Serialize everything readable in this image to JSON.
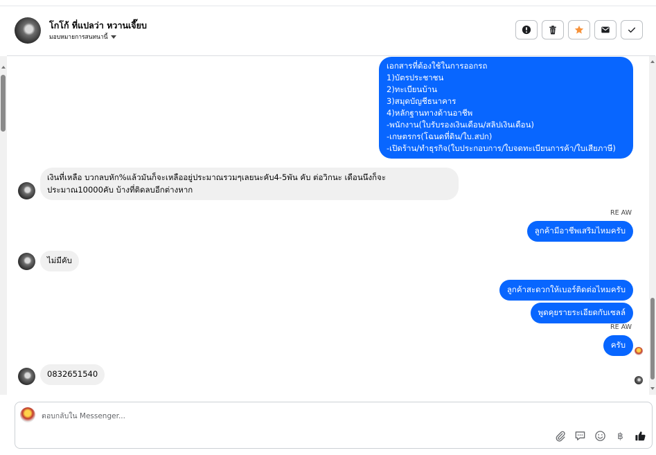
{
  "header": {
    "contact_name": "โกโก้ ที่แปลว่า หวานเจี๊ยบ",
    "assignment_label": "มอบหมายการสนทนานี้",
    "actions": [
      "exclamation-icon",
      "trash-icon",
      "star-icon",
      "envelope-icon",
      "check-icon"
    ],
    "star_color": "#f7923a"
  },
  "messages": [
    {
      "direction": "outgoing",
      "lines": [
        "เอกสารที่ต้องใช้ในการออกรถ",
        "1)บัตรประชาชน",
        "2)ทะเบียนบ้าน",
        "3)สมุดบัญชีธนาคาร",
        "4)หลักฐานทางด้านอาชีพ",
        "-พนักงาน(ใบรับรองเงินเดือน/สลิปเงินเดือน)",
        "-เกษตรกร(โฉนดที่ดิน/ใบ.สปก)",
        "-เปิดร้าน/ทำธุรกิจ(ใบประกอบการ/ใบจดทะเบียนการค้า/ใบเสียภาษี)"
      ]
    },
    {
      "direction": "incoming",
      "lines": [
        "เงินที่เหลือ  บวกลบหัก%แล้วมันก็จะเหลืออยู่ประมาณรวมๆเลยนะคับ4-5พัน คับ  ต่อวิกนะ  เดือนนึงก็จะ",
        "ประมาณ10000คับ  บ้างที่ติดลบอีกต่างหาก"
      ]
    },
    {
      "direction": "outgoing",
      "sender": "RE AW",
      "text": "ลูกค้ามีอาชีพเสริมไหมครับ"
    },
    {
      "direction": "incoming",
      "text": "ไม่มีคับ"
    },
    {
      "direction": "outgoing",
      "text": "ลูกค้าสะดวกให้เบอร์ติดต่อไหมครับ"
    },
    {
      "direction": "outgoing",
      "text": "พูดคุยรายระเอียดกับเซลล์"
    },
    {
      "direction": "outgoing",
      "sender": "RE AW",
      "text": "ครับ"
    },
    {
      "direction": "incoming",
      "text": "0832651540"
    }
  ],
  "colors": {
    "outgoing_bubble": "#0866ff",
    "incoming_bubble": "#f0f0f0"
  },
  "composer": {
    "placeholder": "ตอบกลับใน Messenger...",
    "tools": [
      "paperclip-icon",
      "speech-bubble-icon",
      "smiley-icon",
      "baht-icon",
      "thumbs-up-icon"
    ]
  }
}
